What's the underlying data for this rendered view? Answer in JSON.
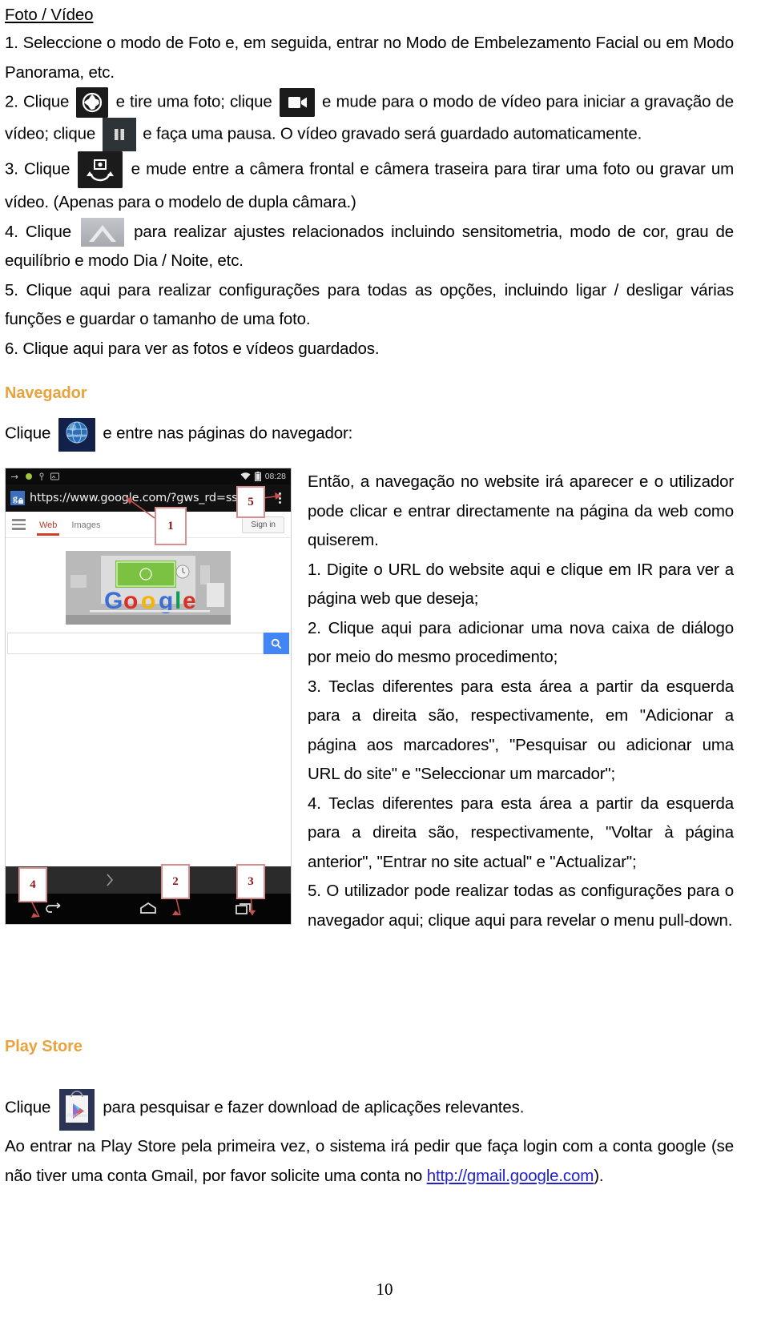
{
  "document": {
    "page_number": "10",
    "sections": {
      "photo_video": {
        "heading": "Foto / Vídeo",
        "item1": "1. Seleccione o modo de Foto e, em seguida, entrar no Modo de Embelezamento Facial ou em Modo Panorama, etc.",
        "item2_a": "2. Clique",
        "item2_b": "e tire uma foto; clique",
        "item2_c": "e mude para o modo de vídeo para iniciar a gravação de vídeo; clique",
        "item2_d": "e faça uma pausa. O vídeo gravado será guardado automaticamente.",
        "item3_a": "3. Clique",
        "item3_b": "e mude entre a câmera frontal e câmera traseira para tirar uma foto ou gravar um vídeo. (Apenas para o modelo de dupla câmara.)",
        "item4_a": "4. Clique",
        "item4_b": "para realizar ajustes relacionados incluindo sensitometria, modo de cor, grau de equilíbrio e modo Dia / Noite, etc.",
        "item5": "5. Clique aqui para realizar configurações para todas as opções, incluindo ligar / desligar várias funções e guardar o tamanho de uma foto.",
        "item6": "6. Clique aqui para ver as fotos e vídeos guardados."
      },
      "browser": {
        "heading": "Navegador",
        "intro_a": "Clique",
        "intro_b": "e entre nas páginas do navegador:",
        "browser_icon_label": "Browser",
        "right_paragraphs": [
          "Então, a navegação no website irá aparecer e o utilizador pode clicar e entrar directamente na página da web como quiserem.",
          "1. Digite o URL do website aqui e clique em IR para ver a página web que deseja;",
          "2. Clique aqui para adicionar uma nova caixa de diálogo por meio do mesmo procedimento;",
          "3. Teclas diferentes para esta área a partir da esquerda para a direita são, respectivamente, em \"Adicionar a página aos marcadores\", \"Pesquisar ou adicionar uma URL do site\" e \"Seleccionar um marcador\";",
          "4. Teclas diferentes para esta área a partir da esquerda para a direita são, respectivamente, \"Voltar à página anterior\", \"Entrar no site actual\" e \"Actualizar\";",
          "5. O utilizador pode realizar todas as configurações para o navegador aqui; clique aqui para revelar o menu pull-down."
        ]
      },
      "play_store": {
        "heading": "Play Store",
        "icon_label": "PlayStore",
        "line1_a": "Clique",
        "line1_b": "para pesquisar e fazer download de aplicações relevantes.",
        "line2_a": "Ao entrar na Play Store pela primeira vez, o sistema irá pedir que faça login com a conta google (se não tiver uma conta Gmail, por favor solicite uma conta no ",
        "line2_link": "http://gmail.google.com",
        "line2_b": ")."
      }
    }
  },
  "phone_screenshot": {
    "status_bar": {
      "time": "08:28"
    },
    "url_bar": {
      "url": "https://www.google.com/?gws_rd=ssl"
    },
    "google_page": {
      "tab_web": "Web",
      "tab_images": "Images",
      "sign_in": "Sign in",
      "search_value": ""
    },
    "callouts": [
      "1",
      "2",
      "3",
      "4",
      "5"
    ]
  },
  "colors": {
    "accent_orange": "#E8A33D",
    "link_blue": "#2222CC",
    "callout_red": "#8b1a1a",
    "status_bar_bg": "#0b0b0b",
    "url_bar_bg": "#111111",
    "google_blue": "#4285f4"
  }
}
